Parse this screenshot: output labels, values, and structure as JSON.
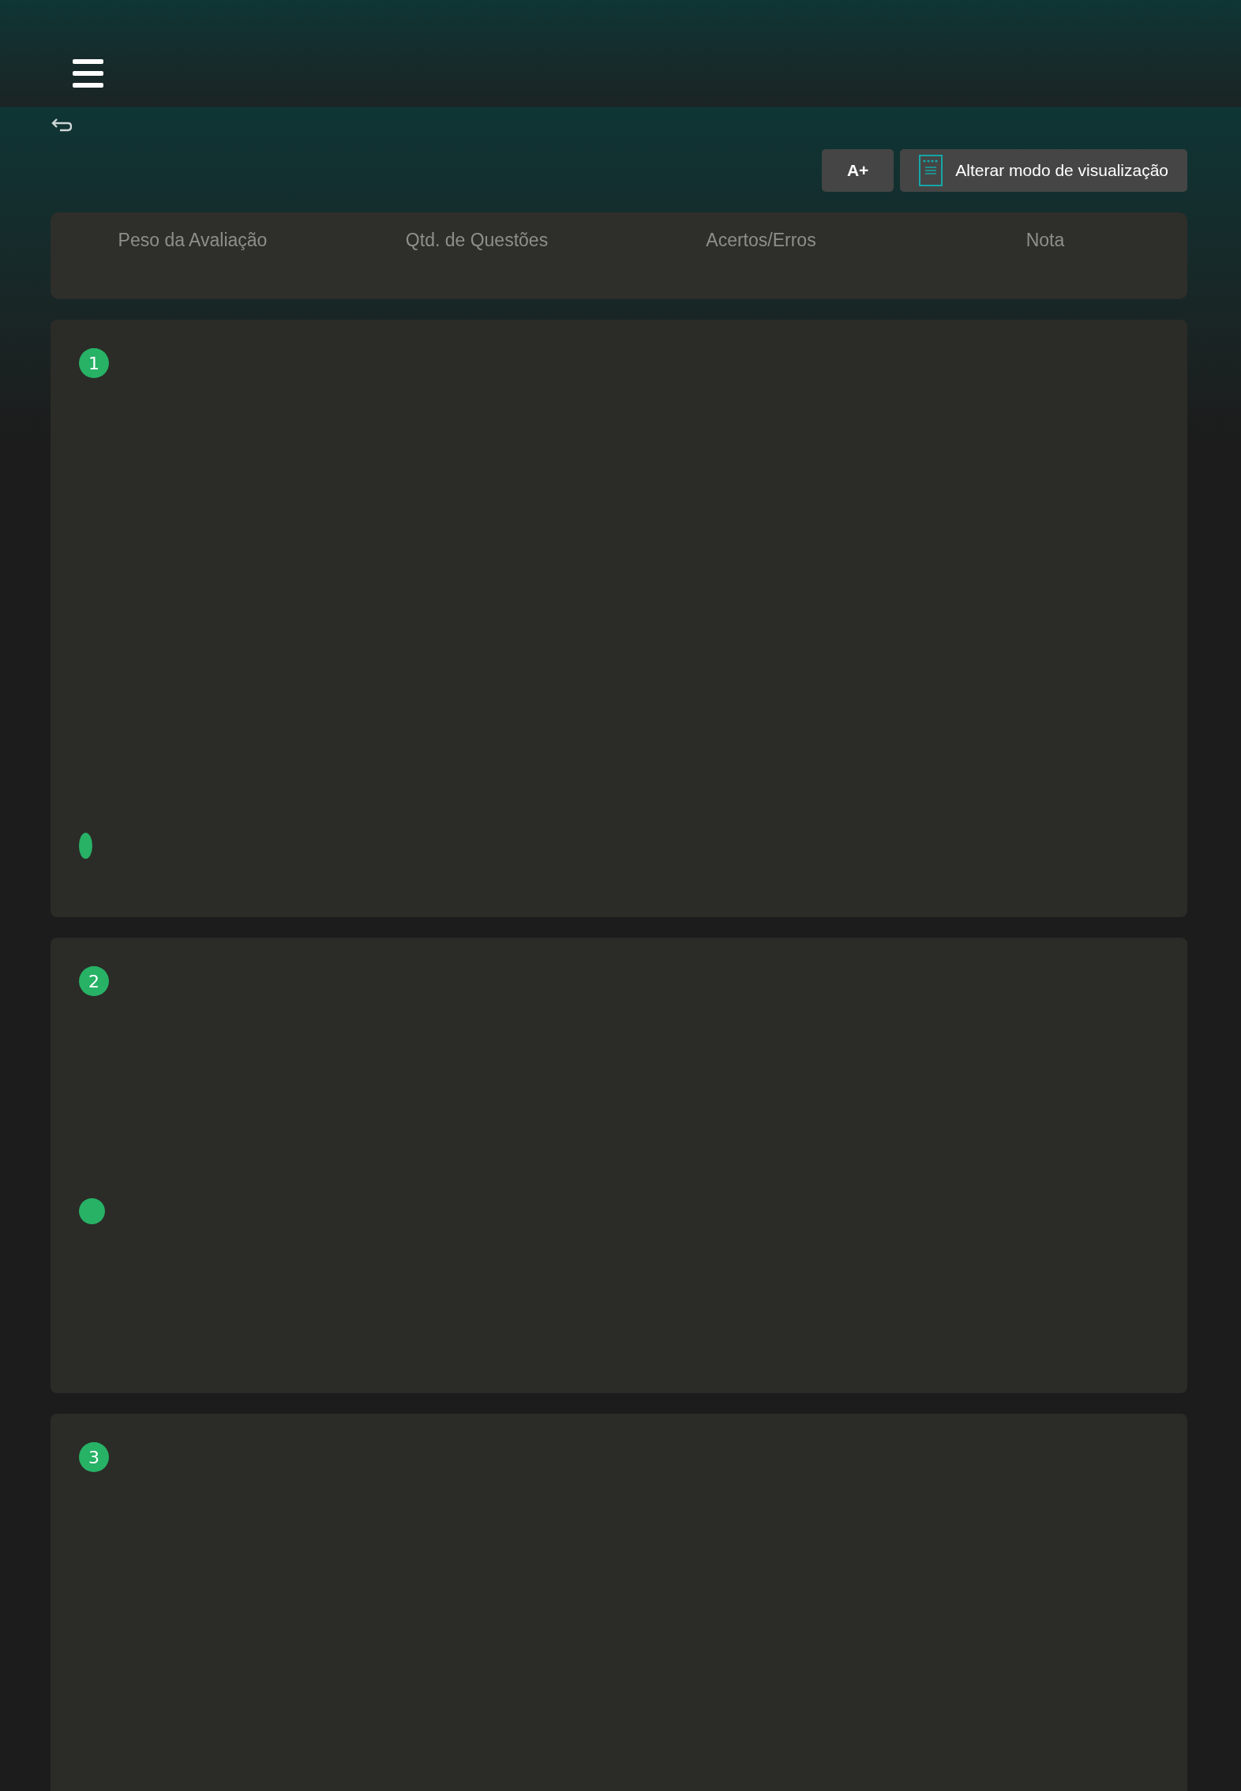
{
  "toolbar": {
    "font_button": "A+",
    "view_button": "Alterar modo de visualização"
  },
  "summary": {
    "columns": [
      "Peso da Avaliação",
      "Qtd. de Questões",
      "Acertos/Erros",
      "Nota"
    ]
  },
  "questions": [
    {
      "number": "1",
      "kind": "oval"
    },
    {
      "number": "2",
      "kind": "dot"
    },
    {
      "number": "3",
      "kind": "plain"
    }
  ]
}
